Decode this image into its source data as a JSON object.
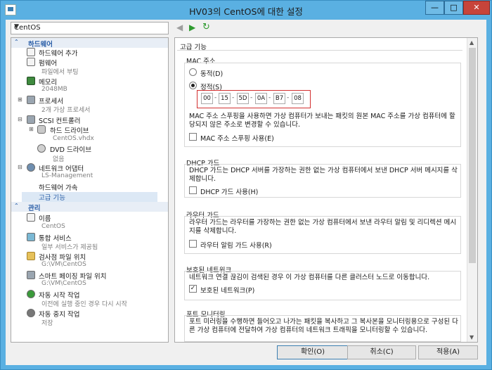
{
  "window": {
    "title": "HV03의 CentOS에 대한 설정"
  },
  "vm_selector": {
    "value": "CentOS"
  },
  "tree": {
    "hardware_header": "하드웨어",
    "management_header": "관리",
    "items": [
      {
        "label": "하드웨어 추가"
      },
      {
        "label": "펌웨어",
        "sub": "파일에서 부팅"
      },
      {
        "label": "메모리",
        "sub": "2048MB"
      },
      {
        "label": "프로세서",
        "sub": "2개 가상 프로세서"
      },
      {
        "label": "SCSI 컨트롤러"
      },
      {
        "label": "하드 드라이브",
        "sub": "CentOS.vhdx"
      },
      {
        "label": "DVD 드라이브",
        "sub": "없음"
      },
      {
        "label": "네트워크 어댑터",
        "sub": "LS-Management"
      },
      {
        "label": "하드웨어 가속"
      },
      {
        "label": "고급 기능"
      }
    ],
    "mgmt_items": [
      {
        "label": "이름",
        "sub": "CentOS"
      },
      {
        "label": "통합 서비스",
        "sub": "일부 서비스가 제공됨"
      },
      {
        "label": "검사점 파일 위치",
        "sub": "G:\\VM\\CentOS"
      },
      {
        "label": "스마트 페이징 파일 위치",
        "sub": "G:\\VM\\CentOS"
      },
      {
        "label": "자동 시작 작업",
        "sub": "이전에 실행 중인 경우 다시 시작"
      },
      {
        "label": "자동 중지 작업",
        "sub": "저장"
      }
    ]
  },
  "details": {
    "heading": "고급 기능",
    "mac": {
      "title": "MAC 주소",
      "dynamic_label": "동적(D)",
      "static_label": "정적(S)",
      "octets": [
        "00",
        "15",
        "5D",
        "0A",
        "B7",
        "08"
      ],
      "spoof_desc": "MAC 주소 스푸핑을 사용하면 가상 컴퓨터가 보내는 패킷의 원본 MAC 주소를 가상 컴퓨터에 할당되지 않은 주소로 변경할 수 있습니다.",
      "spoof_label": "MAC 주소 스푸핑 사용(E)"
    },
    "dhcp": {
      "title": "DHCP 가드",
      "desc": "DHCP 가드는 DHCP 서버를 가장하는 권한 없는 가상 컴퓨터에서 보낸 DHCP 서버 메시지를 삭제합니다.",
      "label": "DHCP 가드 사용(H)"
    },
    "router": {
      "title": "라우터 가드",
      "desc": "라우터 가드는 라우터를 가장하는 권한 없는 가상 컴퓨터에서 보낸 라우터 알림 및 리디렉션 메시지를 삭제합니다.",
      "label": "라우터 알림 가드 사용(R)"
    },
    "protected": {
      "title": "보호된 네트워크",
      "desc": "네트워크 연결 끊김이 검색된 경우 이 가상 컴퓨터를 다른 클러스터 노드로 이동합니다.",
      "label": "보호된 네트워크(P)"
    },
    "port_monitor": {
      "title": "포트 모니터링",
      "desc": "포트 미러링을 수행하면 들어오고 나가는 패킷을 복사하고 그 복사본을 모니터링용으로 구성된 다른 가상 컴퓨터에 전달하여 가상 컴퓨터의 네트워크 트래픽을 모니터링할 수 있습니다."
    }
  },
  "buttons": {
    "ok": "확인(O)",
    "cancel": "취소(C)",
    "apply": "적용(A)"
  }
}
